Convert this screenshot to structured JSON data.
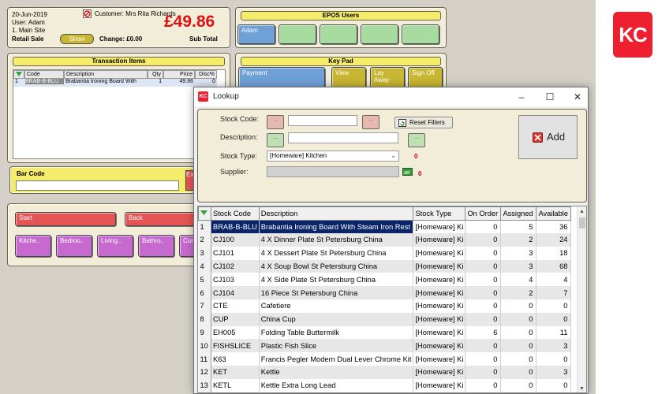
{
  "header": {
    "date": "20-Jun-2019",
    "user": "User: Adam",
    "site": "1. Main Site",
    "mode": "Retail Sale",
    "show_button": "Show",
    "customer": "Customer: Mrs Rita Richards",
    "total": "£49.86",
    "change": "Change: £0.00",
    "subtotal_label": "Sub Total"
  },
  "epos": {
    "title": "EPOS Users",
    "users": [
      "Adam",
      "",
      "",
      "",
      ""
    ]
  },
  "transaction": {
    "title": "Transaction Items",
    "columns": [
      "Code",
      "Description",
      "Qty",
      "Price",
      "Disc%"
    ],
    "rows": [
      {
        "idx": "1",
        "code": "BRAB-B-BLU",
        "description": "Brabantia Ironing Board With",
        "qty": "1",
        "price": "49.86",
        "disc": "0"
      }
    ]
  },
  "barcode": {
    "label": "Bar Code",
    "button": "Ex"
  },
  "keypad": {
    "title": "Key Pad",
    "buttons": [
      "Payment",
      "View",
      "Lay Away",
      "Sign Off"
    ]
  },
  "categories": {
    "start": "Start",
    "back": "Back",
    "items": [
      "Kitche..",
      "Bedroo..",
      "Living..",
      "Bathro..",
      "Cur"
    ]
  },
  "lookup": {
    "title": "Lookup",
    "stock_code_label": "Stock Code:",
    "description_label": "Description:",
    "stock_type_label": "Stock Type:",
    "stock_type_value": "[Homeware] Kitchen",
    "supplier_label": "Supplier:",
    "mini_button_text": "...",
    "reset_filters": "Reset Filters",
    "add": "Add",
    "zero1": "0",
    "zero2": "0",
    "columns": [
      "Stock Code",
      "Description",
      "Stock Type",
      "On Order",
      "Assigned",
      "Available"
    ],
    "rows": [
      {
        "idx": "1",
        "code": "BRAB-B-BLU",
        "description": "Brabantia Ironing Board With Steam Iron Rest",
        "type": "[Homeware] Ki",
        "on_order": "0",
        "assigned": "5",
        "available": "36"
      },
      {
        "idx": "2",
        "code": "CJ100",
        "description": "4 X Dinner Plate St Petersburg China",
        "type": "[Homeware] Ki",
        "on_order": "0",
        "assigned": "2",
        "available": "24"
      },
      {
        "idx": "3",
        "code": "CJ101",
        "description": "4 X Dessert Plate St Petersburg China",
        "type": "[Homeware] Ki",
        "on_order": "0",
        "assigned": "3",
        "available": "18"
      },
      {
        "idx": "4",
        "code": "CJ102",
        "description": "4 X Soup Bowl St Petersburg China",
        "type": "[Homeware] Ki",
        "on_order": "0",
        "assigned": "3",
        "available": "68"
      },
      {
        "idx": "5",
        "code": "CJ103",
        "description": "4 X Side Plate St Petersburg China",
        "type": "[Homeware] Ki",
        "on_order": "0",
        "assigned": "4",
        "available": "4"
      },
      {
        "idx": "6",
        "code": "CJ104",
        "description": "16 Piece St Petersburg China",
        "type": "[Homeware] Ki",
        "on_order": "0",
        "assigned": "2",
        "available": "7"
      },
      {
        "idx": "7",
        "code": "CTE",
        "description": "Cafetiere",
        "type": "[Homeware] Ki",
        "on_order": "0",
        "assigned": "0",
        "available": "0"
      },
      {
        "idx": "8",
        "code": "CUP",
        "description": "China Cup",
        "type": "[Homeware] Ki",
        "on_order": "0",
        "assigned": "0",
        "available": "0"
      },
      {
        "idx": "9",
        "code": "EH005",
        "description": "Folding Table Buttermilk",
        "type": "[Homeware] Ki",
        "on_order": "6",
        "assigned": "0",
        "available": "11"
      },
      {
        "idx": "10",
        "code": "FISHSLICE",
        "description": "Plastic Fish Slice",
        "type": "[Homeware] Ki",
        "on_order": "0",
        "assigned": "0",
        "available": "3"
      },
      {
        "idx": "11",
        "code": "K63",
        "description": "Francis Pegler Modern Dual Lever Chrome Kit",
        "type": "[Homeware] Ki",
        "on_order": "0",
        "assigned": "0",
        "available": "0"
      },
      {
        "idx": "12",
        "code": "KET",
        "description": "Kettle",
        "type": "[Homeware] Ki",
        "on_order": "0",
        "assigned": "0",
        "available": "3"
      },
      {
        "idx": "13",
        "code": "KETL",
        "description": "Kettle Extra Long Lead",
        "type": "[Homeware] Ki",
        "on_order": "0",
        "assigned": "0",
        "available": "0"
      }
    ]
  },
  "brand": {
    "logo_text": "KC",
    "accent": "#ee1f2e"
  },
  "colors": {
    "total_red": "#e01010",
    "selection": "#0a246a"
  }
}
